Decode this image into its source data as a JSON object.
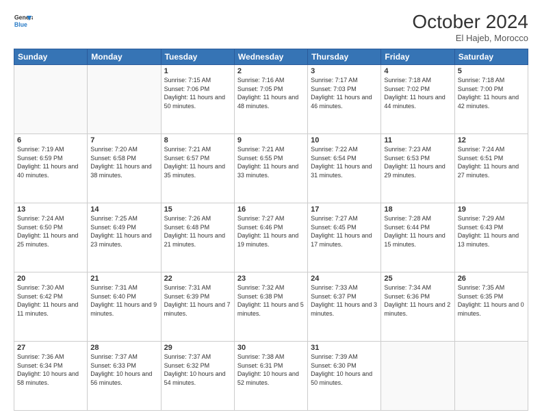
{
  "header": {
    "logo_line1": "General",
    "logo_line2": "Blue",
    "month": "October 2024",
    "location": "El Hajeb, Morocco"
  },
  "weekdays": [
    "Sunday",
    "Monday",
    "Tuesday",
    "Wednesday",
    "Thursday",
    "Friday",
    "Saturday"
  ],
  "weeks": [
    [
      {
        "day": "",
        "info": ""
      },
      {
        "day": "",
        "info": ""
      },
      {
        "day": "1",
        "info": "Sunrise: 7:15 AM\nSunset: 7:06 PM\nDaylight: 11 hours and 50 minutes."
      },
      {
        "day": "2",
        "info": "Sunrise: 7:16 AM\nSunset: 7:05 PM\nDaylight: 11 hours and 48 minutes."
      },
      {
        "day": "3",
        "info": "Sunrise: 7:17 AM\nSunset: 7:03 PM\nDaylight: 11 hours and 46 minutes."
      },
      {
        "day": "4",
        "info": "Sunrise: 7:18 AM\nSunset: 7:02 PM\nDaylight: 11 hours and 44 minutes."
      },
      {
        "day": "5",
        "info": "Sunrise: 7:18 AM\nSunset: 7:00 PM\nDaylight: 11 hours and 42 minutes."
      }
    ],
    [
      {
        "day": "6",
        "info": "Sunrise: 7:19 AM\nSunset: 6:59 PM\nDaylight: 11 hours and 40 minutes."
      },
      {
        "day": "7",
        "info": "Sunrise: 7:20 AM\nSunset: 6:58 PM\nDaylight: 11 hours and 38 minutes."
      },
      {
        "day": "8",
        "info": "Sunrise: 7:21 AM\nSunset: 6:57 PM\nDaylight: 11 hours and 35 minutes."
      },
      {
        "day": "9",
        "info": "Sunrise: 7:21 AM\nSunset: 6:55 PM\nDaylight: 11 hours and 33 minutes."
      },
      {
        "day": "10",
        "info": "Sunrise: 7:22 AM\nSunset: 6:54 PM\nDaylight: 11 hours and 31 minutes."
      },
      {
        "day": "11",
        "info": "Sunrise: 7:23 AM\nSunset: 6:53 PM\nDaylight: 11 hours and 29 minutes."
      },
      {
        "day": "12",
        "info": "Sunrise: 7:24 AM\nSunset: 6:51 PM\nDaylight: 11 hours and 27 minutes."
      }
    ],
    [
      {
        "day": "13",
        "info": "Sunrise: 7:24 AM\nSunset: 6:50 PM\nDaylight: 11 hours and 25 minutes."
      },
      {
        "day": "14",
        "info": "Sunrise: 7:25 AM\nSunset: 6:49 PM\nDaylight: 11 hours and 23 minutes."
      },
      {
        "day": "15",
        "info": "Sunrise: 7:26 AM\nSunset: 6:48 PM\nDaylight: 11 hours and 21 minutes."
      },
      {
        "day": "16",
        "info": "Sunrise: 7:27 AM\nSunset: 6:46 PM\nDaylight: 11 hours and 19 minutes."
      },
      {
        "day": "17",
        "info": "Sunrise: 7:27 AM\nSunset: 6:45 PM\nDaylight: 11 hours and 17 minutes."
      },
      {
        "day": "18",
        "info": "Sunrise: 7:28 AM\nSunset: 6:44 PM\nDaylight: 11 hours and 15 minutes."
      },
      {
        "day": "19",
        "info": "Sunrise: 7:29 AM\nSunset: 6:43 PM\nDaylight: 11 hours and 13 minutes."
      }
    ],
    [
      {
        "day": "20",
        "info": "Sunrise: 7:30 AM\nSunset: 6:42 PM\nDaylight: 11 hours and 11 minutes."
      },
      {
        "day": "21",
        "info": "Sunrise: 7:31 AM\nSunset: 6:40 PM\nDaylight: 11 hours and 9 minutes."
      },
      {
        "day": "22",
        "info": "Sunrise: 7:31 AM\nSunset: 6:39 PM\nDaylight: 11 hours and 7 minutes."
      },
      {
        "day": "23",
        "info": "Sunrise: 7:32 AM\nSunset: 6:38 PM\nDaylight: 11 hours and 5 minutes."
      },
      {
        "day": "24",
        "info": "Sunrise: 7:33 AM\nSunset: 6:37 PM\nDaylight: 11 hours and 3 minutes."
      },
      {
        "day": "25",
        "info": "Sunrise: 7:34 AM\nSunset: 6:36 PM\nDaylight: 11 hours and 2 minutes."
      },
      {
        "day": "26",
        "info": "Sunrise: 7:35 AM\nSunset: 6:35 PM\nDaylight: 11 hours and 0 minutes."
      }
    ],
    [
      {
        "day": "27",
        "info": "Sunrise: 7:36 AM\nSunset: 6:34 PM\nDaylight: 10 hours and 58 minutes."
      },
      {
        "day": "28",
        "info": "Sunrise: 7:37 AM\nSunset: 6:33 PM\nDaylight: 10 hours and 56 minutes."
      },
      {
        "day": "29",
        "info": "Sunrise: 7:37 AM\nSunset: 6:32 PM\nDaylight: 10 hours and 54 minutes."
      },
      {
        "day": "30",
        "info": "Sunrise: 7:38 AM\nSunset: 6:31 PM\nDaylight: 10 hours and 52 minutes."
      },
      {
        "day": "31",
        "info": "Sunrise: 7:39 AM\nSunset: 6:30 PM\nDaylight: 10 hours and 50 minutes."
      },
      {
        "day": "",
        "info": ""
      },
      {
        "day": "",
        "info": ""
      }
    ]
  ]
}
